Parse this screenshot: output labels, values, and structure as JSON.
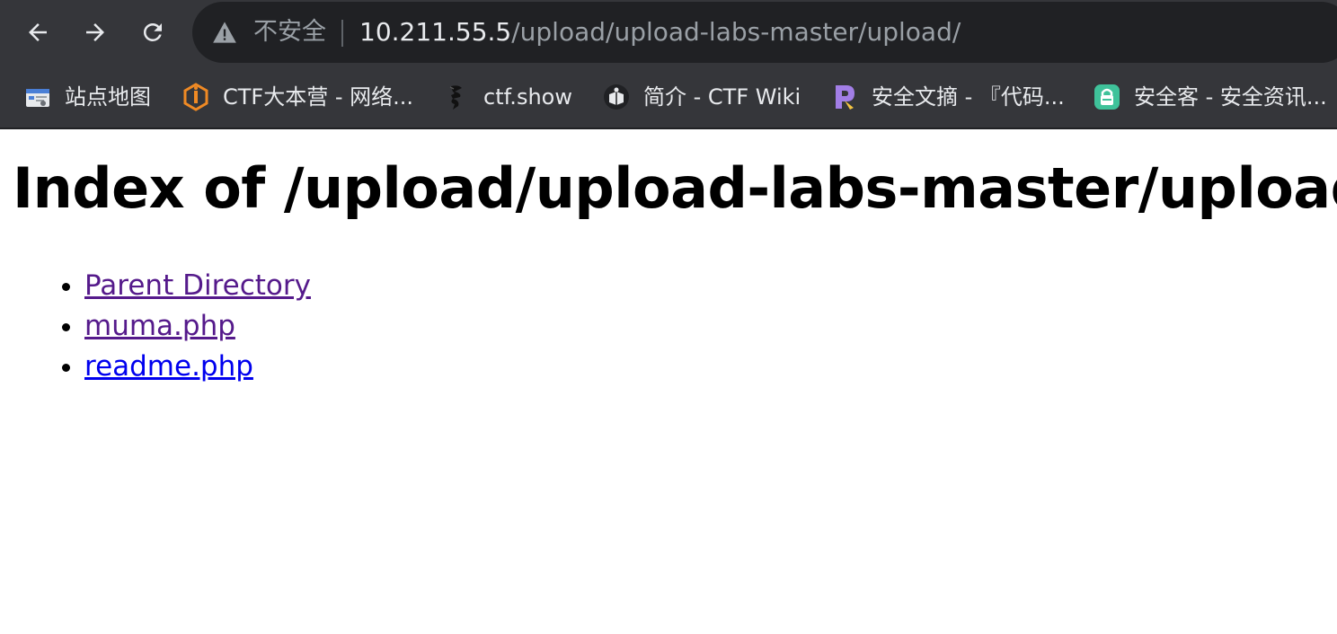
{
  "browser": {
    "security_label": "不安全",
    "url_host": "10.211.55.5",
    "url_path": "/upload/upload-labs-master/upload/",
    "bookmarks": [
      {
        "label": "站点地图",
        "icon": "sitemap-icon"
      },
      {
        "label": "CTF大本营 - 网络...",
        "icon": "ichunqiu-icon"
      },
      {
        "label": "ctf.show",
        "icon": "ctfshow-icon"
      },
      {
        "label": "简介 - CTF Wiki",
        "icon": "ctfwiki-icon"
      },
      {
        "label": "安全文摘 - 『代码...",
        "icon": "p-logo-icon"
      },
      {
        "label": "安全客 - 安全资讯...",
        "icon": "anquanke-icon"
      }
    ]
  },
  "page": {
    "title": "Index of /upload/upload-labs-master/upload",
    "entries": [
      {
        "label": "Parent Directory",
        "visited": true
      },
      {
        "label": "muma.php",
        "visited": true
      },
      {
        "label": "readme.php",
        "visited": false
      }
    ]
  },
  "colors": {
    "chrome_bg": "#35363a",
    "omnibox_bg": "#202124",
    "visited_link": "#551a8b",
    "unvisited_link": "#0000ee"
  }
}
